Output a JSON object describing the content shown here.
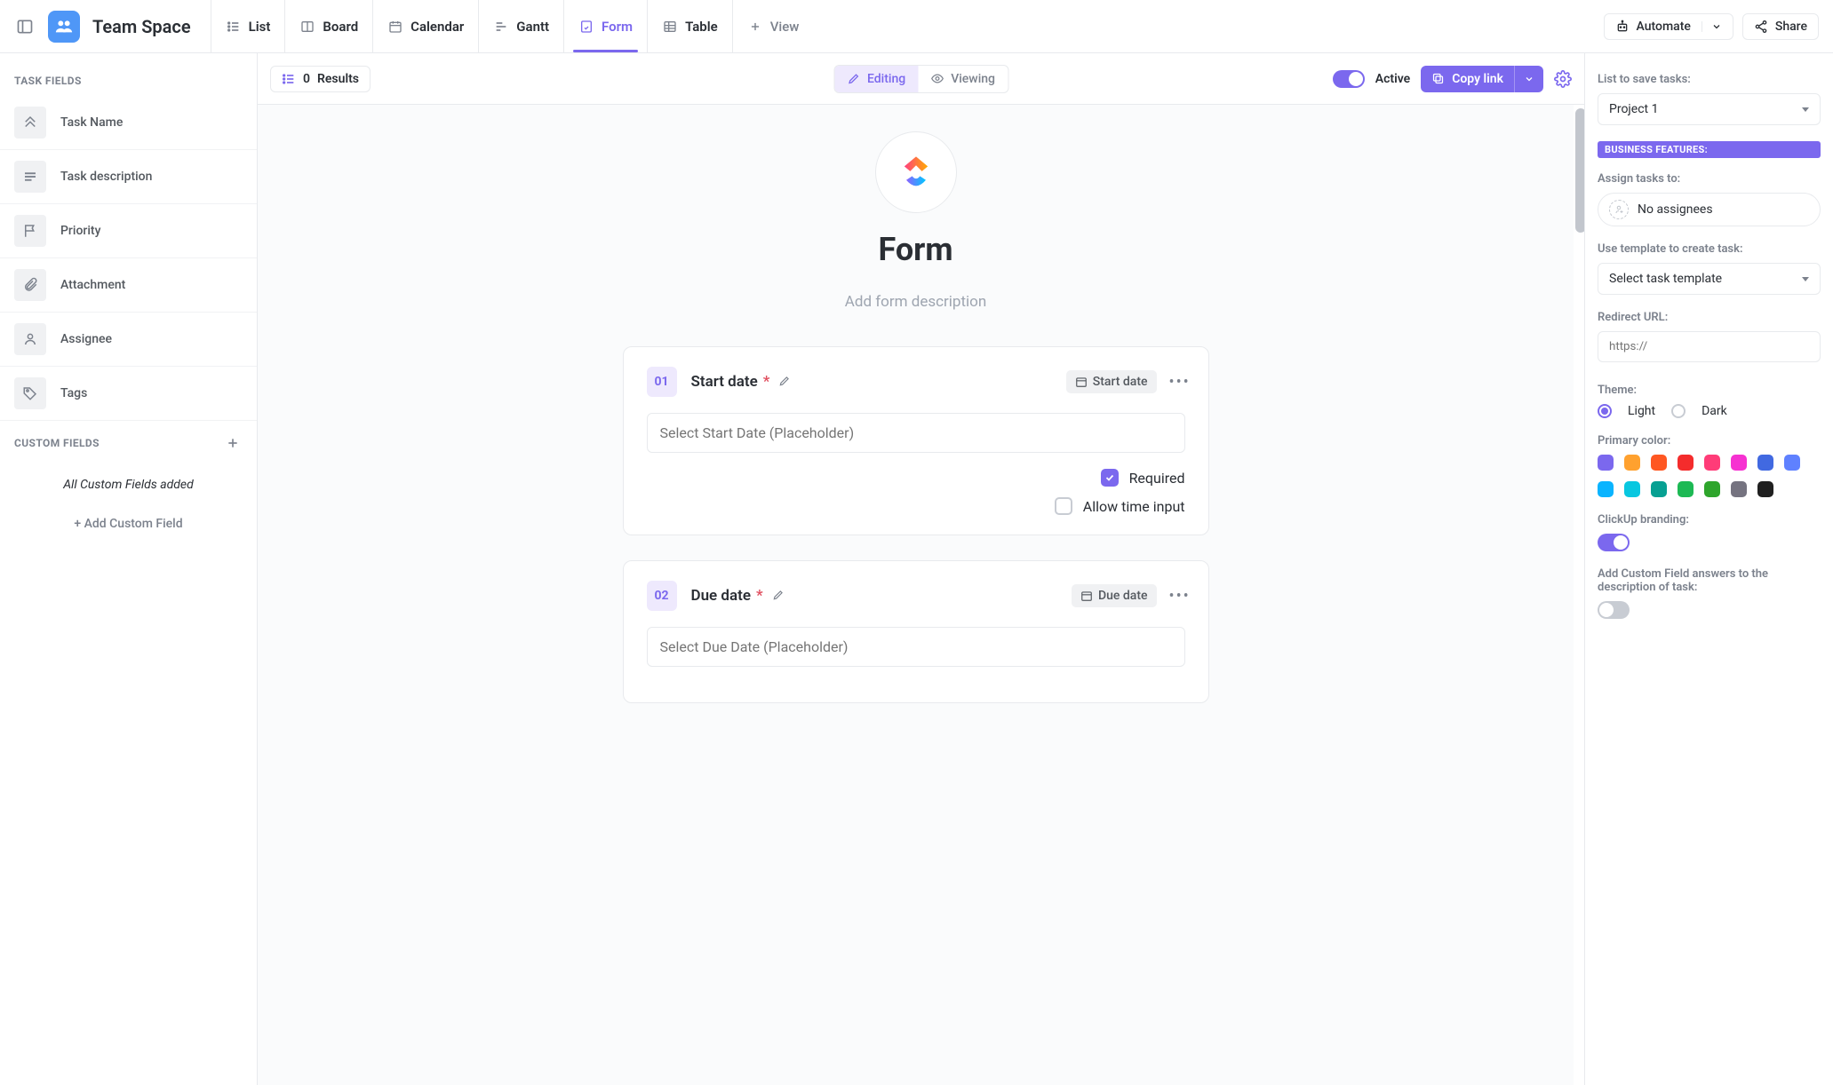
{
  "header": {
    "space_title": "Team Space",
    "views": [
      {
        "label": "List",
        "icon": "list-icon"
      },
      {
        "label": "Board",
        "icon": "board-icon"
      },
      {
        "label": "Calendar",
        "icon": "calendar-icon"
      },
      {
        "label": "Gantt",
        "icon": "gantt-icon"
      },
      {
        "label": "Form",
        "icon": "form-icon",
        "active": true
      },
      {
        "label": "Table",
        "icon": "table-icon"
      }
    ],
    "add_view": "View",
    "automate": "Automate",
    "share": "Share"
  },
  "left": {
    "task_fields_title": "TASK FIELDS",
    "fields": [
      {
        "label": "Task Name"
      },
      {
        "label": "Task description"
      },
      {
        "label": "Priority"
      },
      {
        "label": "Attachment"
      },
      {
        "label": "Assignee"
      },
      {
        "label": "Tags"
      }
    ],
    "custom_fields_title": "CUSTOM FIELDS",
    "custom_empty": "All Custom Fields added",
    "add_custom": "+ Add Custom Field"
  },
  "center": {
    "results_count": "0",
    "results_label": "Results",
    "editing": "Editing",
    "viewing": "Viewing",
    "active_label": "Active",
    "copy_link": "Copy link",
    "form_title": "Form",
    "form_desc": "Add form description",
    "cards": [
      {
        "num": "01",
        "title": "Start date",
        "required": true,
        "chip": "Start date",
        "placeholder": "Select Start Date (Placeholder)",
        "opt_required": "Required",
        "opt_required_checked": true,
        "opt_time": "Allow time input",
        "opt_time_checked": false
      },
      {
        "num": "02",
        "title": "Due date",
        "required": true,
        "chip": "Due date",
        "placeholder": "Select Due Date (Placeholder)"
      }
    ]
  },
  "right": {
    "list_label": "List to save tasks:",
    "list_value": "Project 1",
    "business_badge": "BUSINESS FEATURES:",
    "assign_label": "Assign tasks to:",
    "assign_value": "No assignees",
    "template_label": "Use template to create task:",
    "template_value": "Select task template",
    "redirect_label": "Redirect URL:",
    "redirect_ph": "https://",
    "theme_label": "Theme:",
    "theme_light": "Light",
    "theme_dark": "Dark",
    "primary_label": "Primary color:",
    "colors": [
      "#7b68ee",
      "#ffa12f",
      "#ff5722",
      "#f42c2c",
      "#ff3c78",
      "#f631d1",
      "#4169e1",
      "#5f81ff",
      "#0ab4ff",
      "#08c7e0",
      "#07a092",
      "#1db954",
      "#2ea52c",
      "#757380",
      "#202020"
    ],
    "branding_label": "ClickUp branding:",
    "branding_on": true,
    "add_cf_desc_label": "Add Custom Field answers to the description of task:",
    "add_cf_desc_on": false
  }
}
